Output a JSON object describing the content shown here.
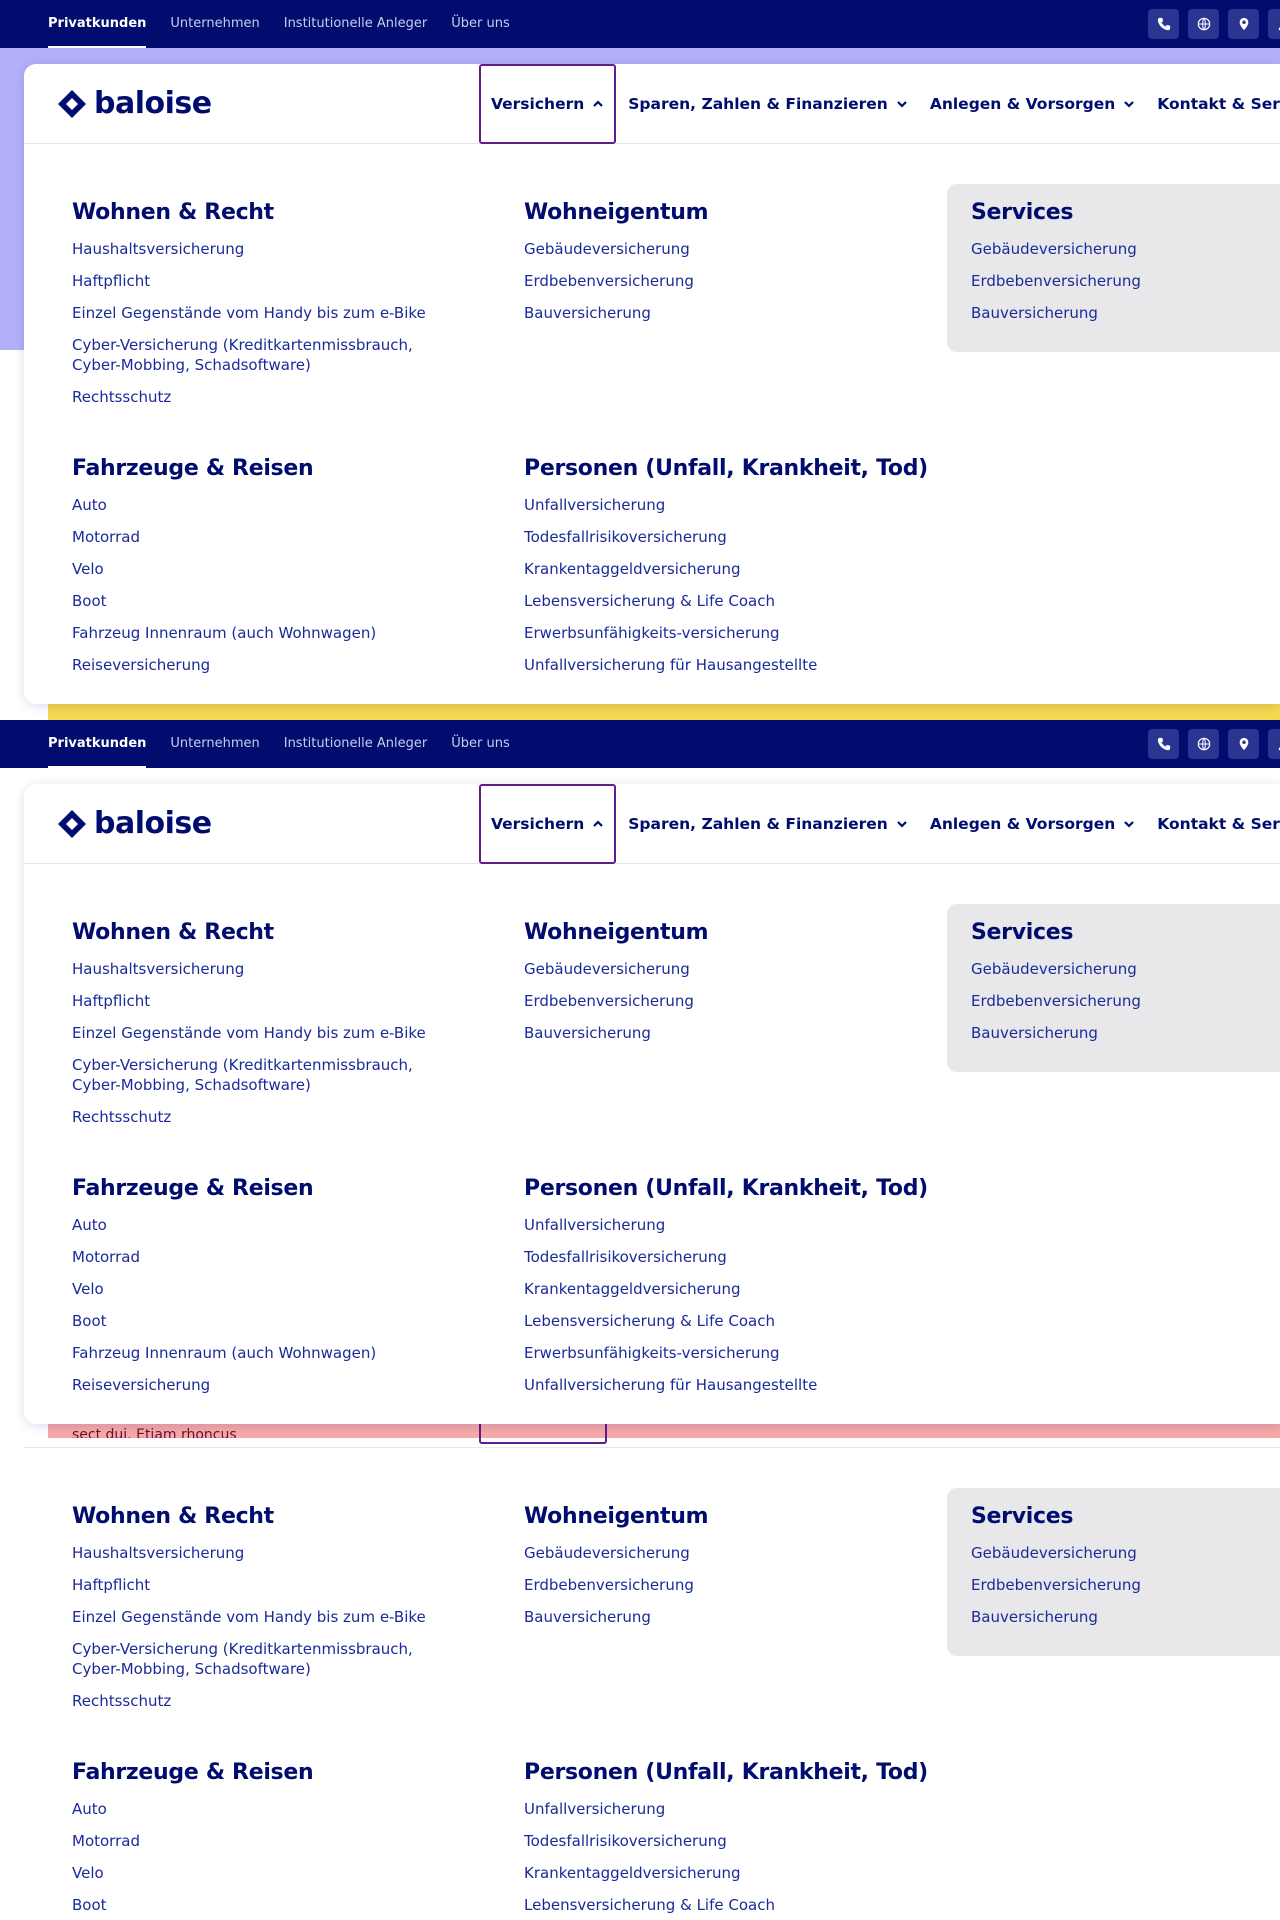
{
  "meta_nav": {
    "links": [
      "Privatkunden",
      "Unternehmen",
      "Institutionelle Anleger",
      "Über uns"
    ],
    "active": "Privatkunden",
    "icons": [
      "phone-icon",
      "globe-icon",
      "location-pin-icon",
      "user-icon"
    ]
  },
  "brand": {
    "name": "baloise",
    "logo_color": "#000d6e"
  },
  "main_nav": [
    {
      "label": "Versichern",
      "expanded": true
    },
    {
      "label": "Sparen, Zahlen & Finanzieren",
      "expanded": false
    },
    {
      "label": "Anlegen & Vorsorgen",
      "expanded": false
    },
    {
      "label": "Kontakt & Services",
      "expanded": false
    }
  ],
  "mega_menu": {
    "wohnen_recht": {
      "title": "Wohnen & Recht",
      "items": [
        "Haushaltsversicherung",
        "Haftpflicht",
        "Einzel Gegenstände vom Handy bis zum e-Bike",
        "Cyber-Versicherung (Kreditkartenmissbrauch, Cyber-Mobbing, Schadsoftware)",
        "Rechtsschutz"
      ]
    },
    "wohneigentum": {
      "title": "Wohneigentum",
      "items": [
        "Gebäudeversicherung",
        "Erdbebenversicherung",
        "Bauversicherung"
      ]
    },
    "services": {
      "title": "Services",
      "items": [
        "Gebäudeversicherung",
        "Erdbebenversicherung",
        "Bauversicherung"
      ]
    },
    "fahrzeuge_reisen": {
      "title": "Fahrzeuge & Reisen",
      "items": [
        "Auto",
        "Motorrad",
        "Velo",
        "Boot",
        "Fahrzeug Innenraum (auch Wohnwagen)",
        "Reiseversicherung"
      ]
    },
    "personen": {
      "title": "Personen (Unfall, Krankheit, Tod)",
      "items": [
        "Unfallversicherung",
        "Todesfallrisikoversicherung",
        "Krankentaggeldversicherung",
        "Lebensversicherung & Life Coach",
        "Erwerbsunfähigkeits-versicherung",
        "Unfallversicherung für Hausangestellte"
      ]
    }
  },
  "background_bleed_text": "sect dui. Etiam rhoncus",
  "colors": {
    "navy": "#000d6e",
    "link": "#1b2a99",
    "active_border": "#5d1e8c",
    "band_lavender": "#b3b0fa",
    "band_yellow": "#f5d94e",
    "band_pink": "#f7a8a8",
    "services_bg": "#e8e8ea"
  }
}
